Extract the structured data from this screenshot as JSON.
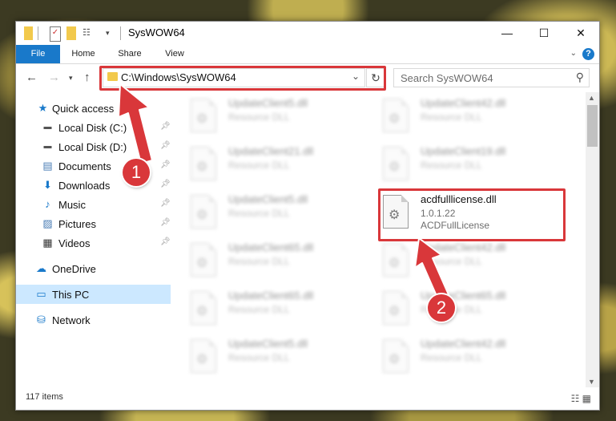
{
  "window": {
    "title": "SysWOW64"
  },
  "window_controls": {
    "minimize": "—",
    "maximize": "☐",
    "close": "✕"
  },
  "ribbon": {
    "tabs": [
      "File",
      "Home",
      "Share",
      "View"
    ],
    "help": "?"
  },
  "address": {
    "path": "C:\\Windows\\SysWOW64",
    "search_placeholder": "Search SysWOW64"
  },
  "sidebar": {
    "items": [
      {
        "label": "Quick access",
        "icon": "star-icon"
      },
      {
        "label": "Local Disk (C:)",
        "icon": "drive-icon"
      },
      {
        "label": "Local Disk (D:)",
        "icon": "drive-icon"
      },
      {
        "label": "Documents",
        "icon": "documents-icon"
      },
      {
        "label": "Downloads",
        "icon": "download-icon"
      },
      {
        "label": "Music",
        "icon": "music-icon"
      },
      {
        "label": "Pictures",
        "icon": "pictures-icon"
      },
      {
        "label": "Videos",
        "icon": "videos-icon"
      },
      {
        "label": "OneDrive",
        "icon": "cloud-icon"
      },
      {
        "label": "This PC",
        "icon": "computer-icon"
      },
      {
        "label": "Network",
        "icon": "network-icon"
      }
    ]
  },
  "files": {
    "highlighted": {
      "name": "acdfulllicense.dll",
      "version": "1.0.1.22",
      "description": "ACDFullLicense"
    },
    "blurred": [
      {
        "name": "UpdateClient5.dll",
        "desc": "Resource DLL"
      },
      {
        "name": "UpdateClient42.dll",
        "desc": "Resource DLL"
      },
      {
        "name": "UpdateClient21.dll",
        "desc": "Resource DLL"
      },
      {
        "name": "UpdateClient19.dll",
        "desc": "Resource DLL"
      },
      {
        "name": "UpdateClient5.dll",
        "desc": "Resource DLL"
      },
      {
        "name": "UpdateClient65.dll",
        "desc": "Resource DLL"
      },
      {
        "name": "UpdateClient42.dll",
        "desc": "Resource DLL"
      },
      {
        "name": "UpdateClient65.dll",
        "desc": "Resource DLL"
      },
      {
        "name": "UpdateClient65.dll",
        "desc": "Resource DLL"
      },
      {
        "name": "UpdateClient5.dll",
        "desc": "Resource DLL"
      },
      {
        "name": "UpdateClient42.dll",
        "desc": "Resource DLL"
      }
    ]
  },
  "status": {
    "item_count": "117 items"
  },
  "annotations": {
    "step1": "1",
    "step2": "2",
    "color": "#d9373a"
  }
}
